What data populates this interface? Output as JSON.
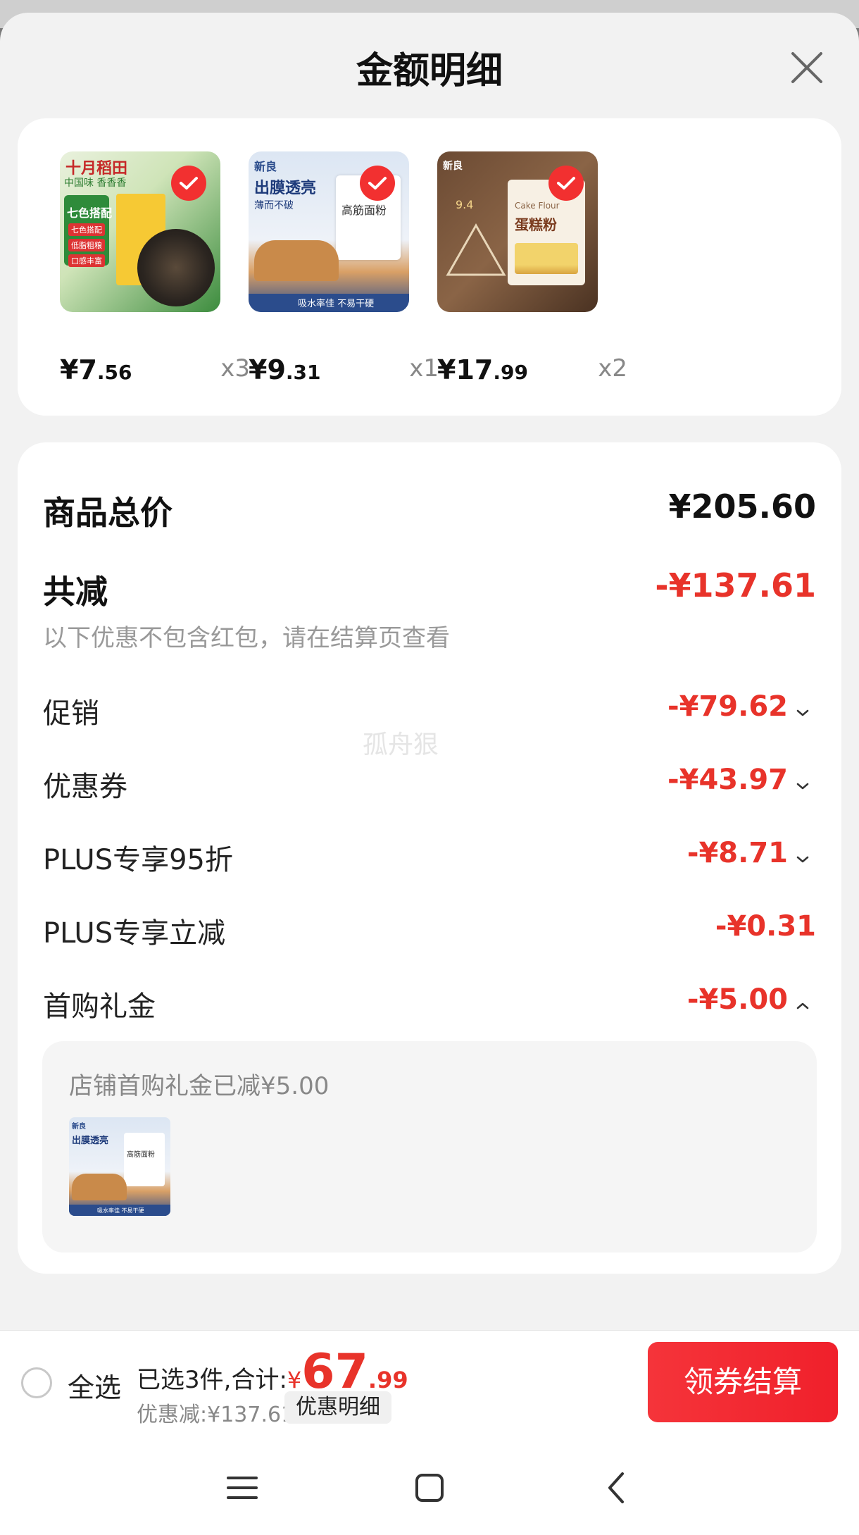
{
  "sheet": {
    "title": "金额明细"
  },
  "products": [
    {
      "price_int": "¥7",
      "price_cents": ".56",
      "qty": "x3",
      "image_text": [
        "十月稻田",
        "中国味 香香香",
        "七色搭配",
        "七色搭配",
        "低脂粗粮",
        "口感丰富"
      ]
    },
    {
      "price_int": "¥9",
      "price_cents": ".31",
      "qty": "x1",
      "image_text": [
        "新良",
        "出膜透亮",
        "薄而不破",
        "高筋面粉",
        "吸水率佳 不易干硬"
      ]
    },
    {
      "price_int": "¥17",
      "price_cents": ".99",
      "qty": "x2",
      "image_text": [
        "新良",
        "9.4",
        "Cake Flour",
        "蛋糕粉"
      ]
    }
  ],
  "summary": {
    "total_label": "商品总价",
    "total_value": "¥205.60",
    "reduce_label": "共减",
    "reduce_value": "-¥137.61",
    "note": "以下优惠不包含红包，请在结算页查看",
    "items": [
      {
        "label": "促销",
        "value": "-¥79.62",
        "toggle": "down"
      },
      {
        "label": "优惠券",
        "value": "-¥43.97",
        "toggle": "down"
      },
      {
        "label": "PLUS专享95折",
        "value": "-¥8.71",
        "toggle": "down"
      },
      {
        "label": "PLUS专享立减",
        "value": "-¥0.31",
        "toggle": "none"
      },
      {
        "label": "首购礼金",
        "value": "-¥5.00",
        "toggle": "up"
      }
    ],
    "gift_detail": "店铺首购礼金已减¥5.00",
    "watermark": "孤舟狠"
  },
  "bottom_bar": {
    "select_all": "全选",
    "selected_prefix": "已选3件,合计:",
    "currency": "¥",
    "amount_int": "67",
    "amount_cents": ".99",
    "discount_line": "优惠减:¥137.61",
    "discount_detail_button": "优惠明细",
    "checkout_button": "领券结算"
  },
  "colors": {
    "accent_red": "#e8332a",
    "button_red": "#f23030",
    "background": "#f2f2f2"
  }
}
